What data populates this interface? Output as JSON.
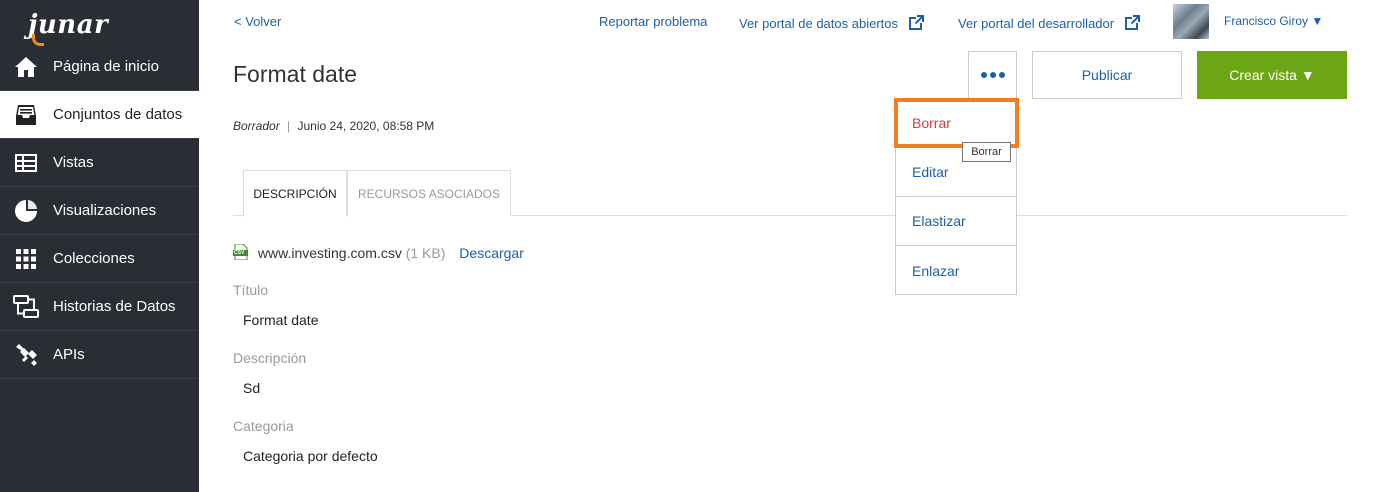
{
  "app": {
    "logo": "junar"
  },
  "sidebar": {
    "items": [
      {
        "label": "Página de inicio",
        "icon": "home-icon"
      },
      {
        "label": "Conjuntos de datos",
        "icon": "inbox-icon",
        "active": true
      },
      {
        "label": "Vistas",
        "icon": "table-icon"
      },
      {
        "label": "Visualizaciones",
        "icon": "pie-chart-icon"
      },
      {
        "label": "Colecciones",
        "icon": "grid-icon"
      },
      {
        "label": "Historias de Datos",
        "icon": "story-icon"
      },
      {
        "label": "APIs",
        "icon": "plug-icon"
      }
    ]
  },
  "header": {
    "back": "< Volver",
    "report": "Reportar problema",
    "open_portal": "Ver portal de datos abiertos",
    "dev_portal": "Ver portal del desarrollador",
    "user": "Francisco Giroy ▼"
  },
  "page": {
    "title": "Format date",
    "status": "Borrador",
    "separator": "|",
    "date": "Junio 24, 2020, 08:58 PM"
  },
  "actions": {
    "publish": "Publicar",
    "create_view": "Crear vista ▼"
  },
  "menu": {
    "items": [
      {
        "label": "Borrar"
      },
      {
        "label": "Editar"
      },
      {
        "label": "Elastizar"
      },
      {
        "label": "Enlazar"
      }
    ],
    "tooltip": "Borrar"
  },
  "tabs": [
    {
      "label": "DESCRIPCIÓN",
      "active": true
    },
    {
      "label": "RECURSOS ASOCIADOS"
    }
  ],
  "file": {
    "icon_label": "CSV",
    "name": "www.investing.com.csv",
    "size": "(1 KB)",
    "download": "Descargar"
  },
  "fields": [
    {
      "label": "Título",
      "value": "Format date"
    },
    {
      "label": "Descripción",
      "value": "Sd"
    },
    {
      "label": "Categoria",
      "value": "Categoria por defecto"
    }
  ],
  "colors": {
    "sidebar_bg": "#2a2d33",
    "link": "#1d5fa8",
    "create_btn": "#6da614",
    "highlight": "#f47d20",
    "danger": "#d33b3b"
  }
}
